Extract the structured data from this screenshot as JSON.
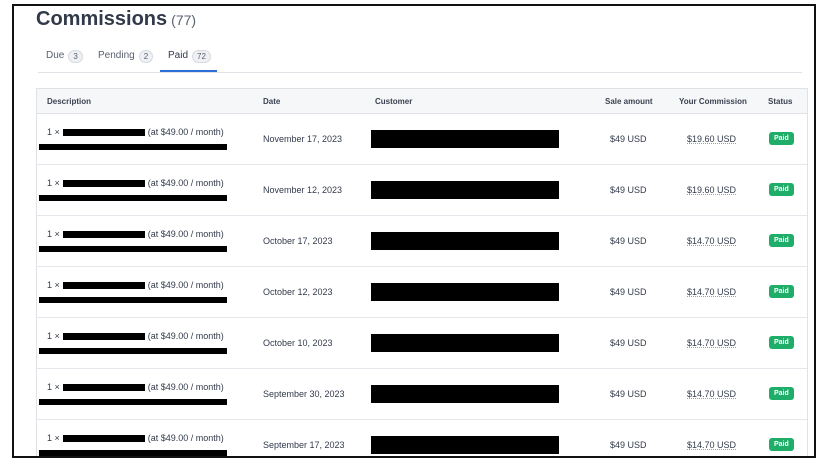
{
  "page": {
    "title": "Commissions",
    "title_count": "(77)"
  },
  "tabs": [
    {
      "label": "Due",
      "count": "3"
    },
    {
      "label": "Pending",
      "count": "2"
    },
    {
      "label": "Paid",
      "count": "72"
    }
  ],
  "table": {
    "headers": [
      "Description",
      "Date",
      "Customer",
      "Sale amount",
      "Your Commission",
      "Status"
    ],
    "rows": [
      {
        "qty": "1 ×",
        "price": "(at $49.00 / month)",
        "date": "November 17, 2023",
        "sale": "$49 USD",
        "commission": "$19.60 USD",
        "status": "Paid"
      },
      {
        "qty": "1 ×",
        "price": "(at $49.00 / month)",
        "date": "November 12, 2023",
        "sale": "$49 USD",
        "commission": "$19.60 USD",
        "status": "Paid"
      },
      {
        "qty": "1 ×",
        "price": "(at $49.00 / month)",
        "date": "October 17, 2023",
        "sale": "$49 USD",
        "commission": "$14.70 USD",
        "status": "Paid"
      },
      {
        "qty": "1 ×",
        "price": "(at $49.00 / month)",
        "date": "October 12, 2023",
        "sale": "$49 USD",
        "commission": "$14.70 USD",
        "status": "Paid"
      },
      {
        "qty": "1 ×",
        "price": "(at $49.00 / month)",
        "date": "October 10, 2023",
        "sale": "$49 USD",
        "commission": "$14.70 USD",
        "status": "Paid"
      },
      {
        "qty": "1 ×",
        "price": "(at $49.00 / month)",
        "date": "September 30, 2023",
        "sale": "$49 USD",
        "commission": "$14.70 USD",
        "status": "Paid"
      },
      {
        "qty": "1 ×",
        "price": "(at $49.00 / month)",
        "date": "September 17, 2023",
        "sale": "$49 USD",
        "commission": "$14.70 USD",
        "status": "Paid"
      }
    ]
  },
  "colors": {
    "accent": "#2d6fd6",
    "paid_badge": "#1fae69",
    "redaction": "#000000"
  }
}
